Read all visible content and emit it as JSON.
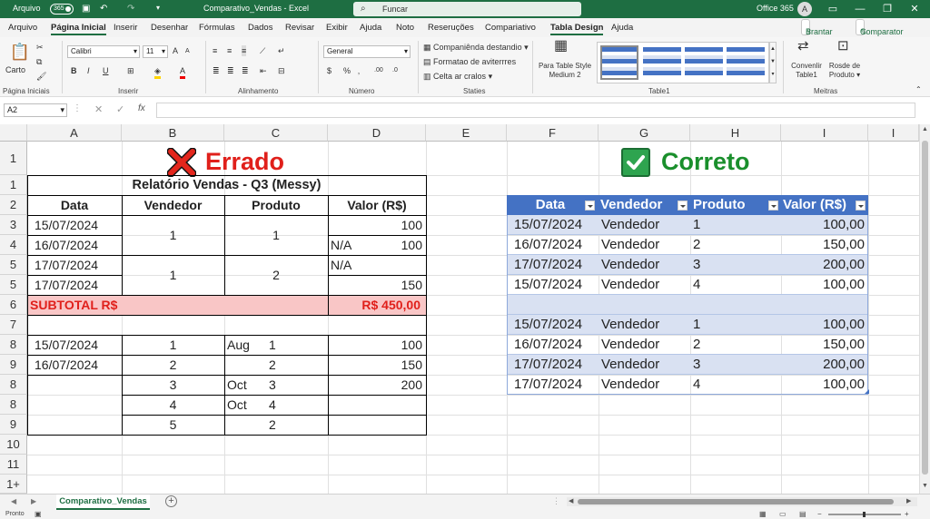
{
  "titlebar": {
    "autosave": "Arquivo",
    "toggle": "365",
    "filename": "Comparativo_Vendas  -  Excel",
    "search": "Funcar",
    "account": "Office 365",
    "avatar": "A"
  },
  "menu": [
    "Arquivo",
    "Página Inicial",
    "Inserir",
    "Desenhar",
    "Fórmulas",
    "Dados",
    "Revisar",
    "Exibir",
    "Ajuda",
    "Noto",
    "Reseruções",
    "Compariativo",
    "Tabla Design",
    "Ajuda"
  ],
  "menu_right": {
    "share": "Brantar",
    "compare": "Comparator"
  },
  "ribbon": {
    "paste": "Carto",
    "font_name": "Calibri",
    "font_size": "11",
    "number_format": "General",
    "cond1": "Companiênda destandio",
    "cond2": "Formatao de aviterrres",
    "cond3": "Celta ar cralos",
    "table_style": "Para Table Style Medium 2",
    "convert": "Convenlir Table1",
    "resize": "Rosde de Produto",
    "groups": {
      "clipboard": "Página Iniciais",
      "font": "Inserir",
      "align": "Alinhamento",
      "number": "Número",
      "styles": "Staties",
      "table": "Table1",
      "macros": "Meitras"
    }
  },
  "formula": {
    "namebox": "A2",
    "fx": "fx"
  },
  "columns": [
    "A",
    "B",
    "C",
    "D",
    "E",
    "F",
    "G",
    "H",
    "I",
    "I"
  ],
  "rows": [
    "1",
    "1",
    "2",
    "3",
    "4",
    "5",
    "5",
    "6",
    "7",
    "8",
    "9",
    "8",
    "8",
    "9",
    "10",
    "11",
    "1+"
  ],
  "left": {
    "heading": "Errado",
    "title": "Relatório Vendas - Q3 (Messy)",
    "headers": [
      "Data",
      "Vendedor",
      "Produto",
      "Valor (R$)"
    ],
    "r3": {
      "date": "15/07/2024",
      "value": "100"
    },
    "r4": {
      "date": "16/07/2024",
      "na": "N/A",
      "value": "100"
    },
    "m1": {
      "vendor": "1",
      "product": "1"
    },
    "r5a": {
      "date": "17/07/2024",
      "na": "N/A"
    },
    "r5b": {
      "date": "17/07/2024",
      "value": "150"
    },
    "m2": {
      "vendor": "1",
      "product": "2"
    },
    "subtotal": {
      "label": "SUBTOTAL R$",
      "value": "R$ 450,00"
    },
    "lower": [
      {
        "date": "15/07/2024",
        "vendor": "1",
        "month": "Aug",
        "product": "1",
        "value": "100"
      },
      {
        "date": "16/07/2024",
        "vendor": "2",
        "month": "",
        "product": "2",
        "value": "150"
      },
      {
        "date": "",
        "vendor": "3",
        "month": "Oct",
        "product": "3",
        "value": "200"
      },
      {
        "date": "",
        "vendor": "4",
        "month": "Oct",
        "product": "4",
        "value": ""
      },
      {
        "date": "",
        "vendor": "5",
        "month": "",
        "product": "2",
        "value": ""
      }
    ]
  },
  "right": {
    "heading": "Correto",
    "headers": [
      "Data",
      "Vendedor",
      "Produto",
      "Valor (R$)"
    ],
    "rows1": [
      {
        "date": "15/07/2024",
        "vendor": "Vendedor",
        "product": "1",
        "value": "100,00"
      },
      {
        "date": "16/07/2024",
        "vendor": "Vendedor",
        "product": "2",
        "value": "150,00"
      },
      {
        "date": "17/07/2024",
        "vendor": "Vendedor",
        "product": "3",
        "value": "200,00"
      },
      {
        "date": "15/07/2024",
        "vendor": "Vendedor",
        "product": "4",
        "value": "100,00"
      }
    ],
    "rows2": [
      {
        "date": "15/07/2024",
        "vendor": "Vendedor",
        "product": "1",
        "value": "100,00"
      },
      {
        "date": "16/07/2024",
        "vendor": "Vendedor",
        "product": "2",
        "value": "150,00"
      },
      {
        "date": "17/07/2024",
        "vendor": "Vendedor",
        "product": "3",
        "value": "200,00"
      },
      {
        "date": "17/07/2024",
        "vendor": "Vendedor",
        "product": "4",
        "value": "100,00"
      }
    ]
  },
  "sheet_tab": "Comparativo_Vendas",
  "status": "Pronto",
  "colors": {
    "excel_green": "#1e6e42",
    "table_blue": "#4472c4",
    "band": "#d9e1f2",
    "subtotal_bg": "#f9c6c6",
    "subtotal_text": "#e0201b",
    "correct_green": "#1a8f2c"
  }
}
